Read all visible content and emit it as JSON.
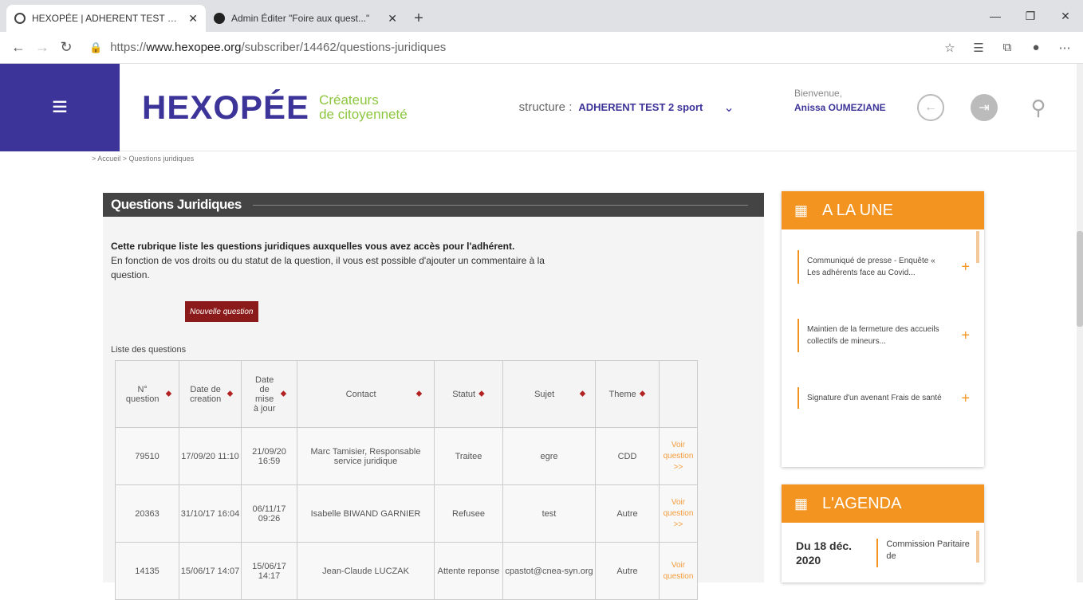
{
  "browser": {
    "tabs": [
      {
        "title": "HEXOPÉE | ADHERENT TEST 2 sp",
        "active": true
      },
      {
        "title": "Admin Éditer \"Foire aux quest...\"",
        "active": false
      }
    ],
    "url_prefix": "https://",
    "url_host": "www.hexopee.org",
    "url_path": "/subscriber/14462/questions-juridiques"
  },
  "header": {
    "brand": "HEXOPÉE",
    "tagline_line1": "Créateurs",
    "tagline_line2": "de citoyenneté",
    "structure_label": "structure :",
    "structure_value": "ADHERENT TEST 2 sport",
    "welcome": "Bienvenue,",
    "user_name": "Anissa OUMEZIANE"
  },
  "breadcrumb": "> Accueil > Questions juridiques",
  "main": {
    "title": "Questions Juridiques",
    "intro_bold": "Cette rubrique liste les questions juridiques auxquelles vous avez accès pour l'adhérent.",
    "intro_text": "En fonction de vos droits ou du statut de la question, il vous est possible d'ajouter un commentaire à la question.",
    "new_button": "Nouvelle question",
    "list_label": "Liste des questions"
  },
  "table": {
    "headers": [
      "N° question",
      "Date de creation",
      "Date de mise à jour",
      "Contact",
      "Statut",
      "Sujet",
      "Theme",
      ""
    ],
    "rows": [
      {
        "num": "79510",
        "created": "17/09/20 11:10",
        "updated": "21/09/20 16:59",
        "contact": "Marc Tamisier, Responsable service juridique",
        "status": "Traitee",
        "subject": "egre",
        "theme": "CDD",
        "link": "Voir question >>"
      },
      {
        "num": "20363",
        "created": "31/10/17 16:04",
        "updated": "06/11/17 09:26",
        "contact": "Isabelle BIWAND GARNIER",
        "status": "Refusee",
        "subject": "test",
        "theme": "Autre",
        "link": "Voir question >>"
      },
      {
        "num": "14135",
        "created": "15/06/17 14:07",
        "updated": "15/06/17 14:17",
        "contact": "Jean-Claude LUCZAK",
        "status": "Attente reponse",
        "subject": "cpastot@cnea-syn.org",
        "theme": "Autre",
        "link": "Voir question"
      }
    ]
  },
  "sidebar": {
    "une_title": "A LA UNE",
    "news": [
      "Communiqué de presse - Enquête « Les adhérents face au Covid...",
      "Maintien de la fermeture des accueils collectifs de mineurs...",
      "Signature d'un avenant Frais de santé"
    ],
    "agenda_title": "L'AGENDA",
    "agenda_date": "Du 18 déc. 2020",
    "agenda_event": "Commission Paritaire de"
  },
  "colors": {
    "brand_purple": "#3d3499",
    "accent_orange": "#f39420",
    "button_red": "#8b1a1a",
    "tagline_green": "#8cc63e"
  }
}
